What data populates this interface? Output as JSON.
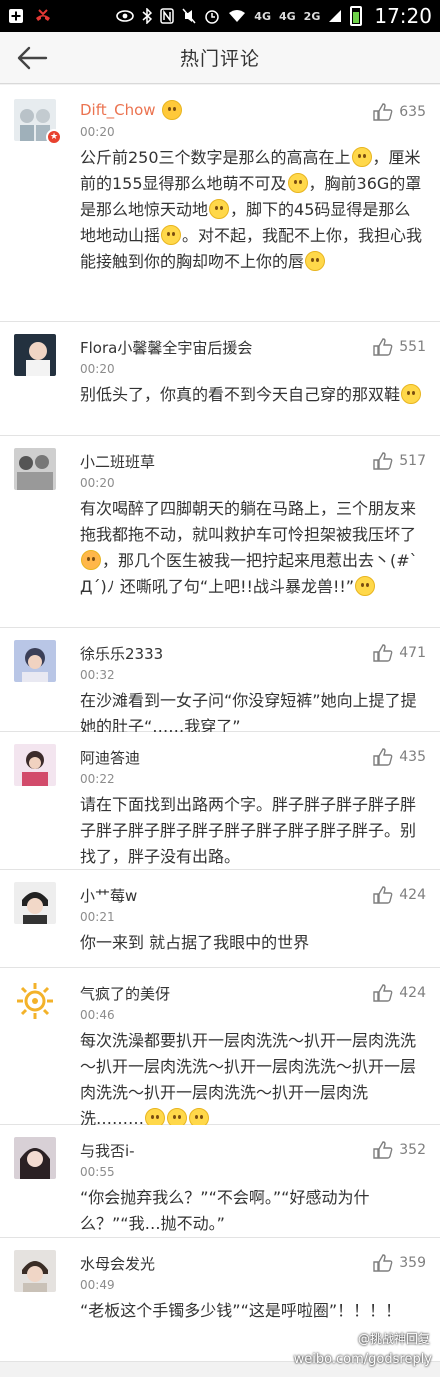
{
  "status_bar": {
    "network_1": "4G",
    "network_2": "4G",
    "network_3": "2G",
    "time": "17:20"
  },
  "header": {
    "title": "热门评论"
  },
  "comments": [
    {
      "user": "Dift_Chow",
      "time": "00:20",
      "likes": "635",
      "parts": [
        "公斤前250三个数字是那么的高高在上",
        "，厘米前的155显得那么地萌不可及",
        "，胸前36G的罩是那么地惊天动地",
        "，脚下的45码显得是那么地地动山摇",
        "。对不起，我配不上你，我担心我能接触到你的胸却吻不上你的唇",
        ""
      ]
    },
    {
      "user": "Flora小馨馨全宇宙后援会",
      "time": "00:20",
      "likes": "551",
      "parts": [
        "别低头了，你真的看不到今天自己穿的那双鞋",
        ""
      ]
    },
    {
      "user": "小二班班草",
      "time": "00:20",
      "likes": "517",
      "parts": [
        "有次喝醉了四脚朝天的躺在马路上，三个朋友来拖我都拖不动，就叫救护车可怜担架被我压坏了",
        "，那几个医生被我一把拧起来甩惹出去丶(#`Д´)ﾉ 还嘶吼了句“上吧!!战斗暴龙兽!!”",
        ""
      ]
    },
    {
      "user": "徐乐乐2333",
      "time": "00:32",
      "likes": "471",
      "parts": [
        "在沙滩看到一女子问“你没穿短裤”她向上提了提她的肚子“……我穿了”"
      ]
    },
    {
      "user": "阿迪答迪",
      "time": "00:22",
      "likes": "435",
      "parts": [
        "请在下面找到出路两个字。胖子胖子胖子胖子胖子胖子胖子胖子胖子胖子胖子胖子胖子胖子。别找了，胖子没有出路。"
      ]
    },
    {
      "user": "小艹莓w",
      "time": "00:21",
      "likes": "424",
      "parts": [
        "你一来到 就占据了我眼中的世界"
      ]
    },
    {
      "user": "气疯了的美伢",
      "time": "00:46",
      "likes": "424",
      "parts": [
        "每次洗澡都要扒开一层肉洗洗～扒开一层肉洗洗～扒开一层肉洗洗～扒开一层肉洗洗～扒开一层肉洗洗～扒开一层肉洗洗～扒开一层肉洗洗………",
        "",
        "",
        ""
      ]
    },
    {
      "user": "与我否i-",
      "time": "00:55",
      "likes": "352",
      "parts": [
        "“你会抛弃我么？”“不会啊。”“好感动为什么？”“我…抛不动。”"
      ]
    },
    {
      "user": "水母会发光",
      "time": "00:49",
      "likes": "359",
      "parts": [
        "“老板这个手镯多少钱”“这是呼啦圈”！！！！"
      ]
    }
  ],
  "watermark": {
    "line1": "@挑战神回复",
    "line2": "weibo.com/godsreply"
  },
  "colors": {
    "vip_name": "#eb7350",
    "badge": "#e8412e",
    "text": "#333333",
    "meta": "#8c8c8c"
  }
}
